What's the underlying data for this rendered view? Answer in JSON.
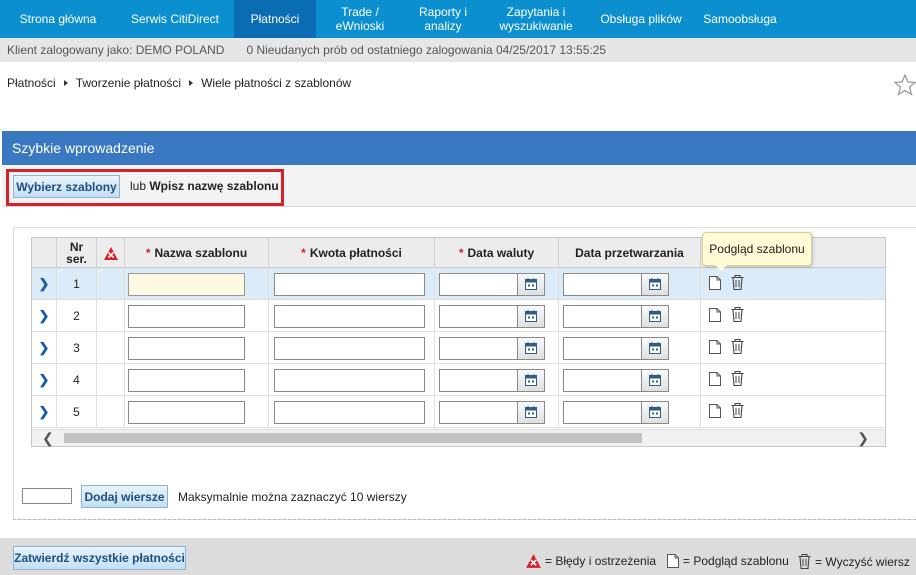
{
  "nav": {
    "items": [
      {
        "label": "Strona główna",
        "active": false
      },
      {
        "label": "Serwis CitiDirect",
        "active": false
      },
      {
        "label": "Płatności",
        "active": true
      },
      {
        "label": "Trade /\neWnioski",
        "active": false
      },
      {
        "label": "Raporty i\nanalizy",
        "active": false
      },
      {
        "label": "Zapytania i\nwyszukiwanie",
        "active": false
      },
      {
        "label": "Obsługa plików",
        "active": false
      },
      {
        "label": "Samoobsługa",
        "active": false
      }
    ]
  },
  "info": {
    "client": "Klient zalogowany jako: DEMO POLAND",
    "attempts": "0 Nieudanych prób od ostatniego zalogowania 04/25/2017 13:55:25"
  },
  "breadcrumb": [
    "Płatności",
    "Tworzenie płatności",
    "Wiele płatności z szablonów"
  ],
  "quick_entry": {
    "title": "Szybkie wprowadzenie",
    "select_button": "Wybierz szablony",
    "or_text": "lub",
    "type_name": "Wpisz nazwę szablonu"
  },
  "grid": {
    "headers": {
      "nr": "Nr\nser.",
      "template_name": "Nazwa szablonu",
      "amount": "Kwota płatności",
      "value_date": "Data waluty",
      "processing_date": "Data przetwarzania",
      "required_mark": "*"
    },
    "rows": [
      {
        "nr": "1",
        "selected": true
      },
      {
        "nr": "2",
        "selected": false
      },
      {
        "nr": "3",
        "selected": false
      },
      {
        "nr": "4",
        "selected": false
      },
      {
        "nr": "5",
        "selected": false
      }
    ],
    "tooltip": "Podgląd szablonu"
  },
  "add_rows": {
    "button": "Dodaj wiersze",
    "info": "Maksymalnie można zaznaczyć 10 wierszy"
  },
  "footer": {
    "confirm_button": "Zatwierdź wszystkie płatności",
    "legend_errors": "= Błędy i ostrzeżenia",
    "legend_preview": "= Podgląd szablonu",
    "legend_clear": "= Wyczyść wiersz"
  },
  "colors": {
    "nav": "#0b8fcf",
    "nav_active": "#0a6db3",
    "header": "#3a78c2",
    "highlight": "#d6202a"
  }
}
